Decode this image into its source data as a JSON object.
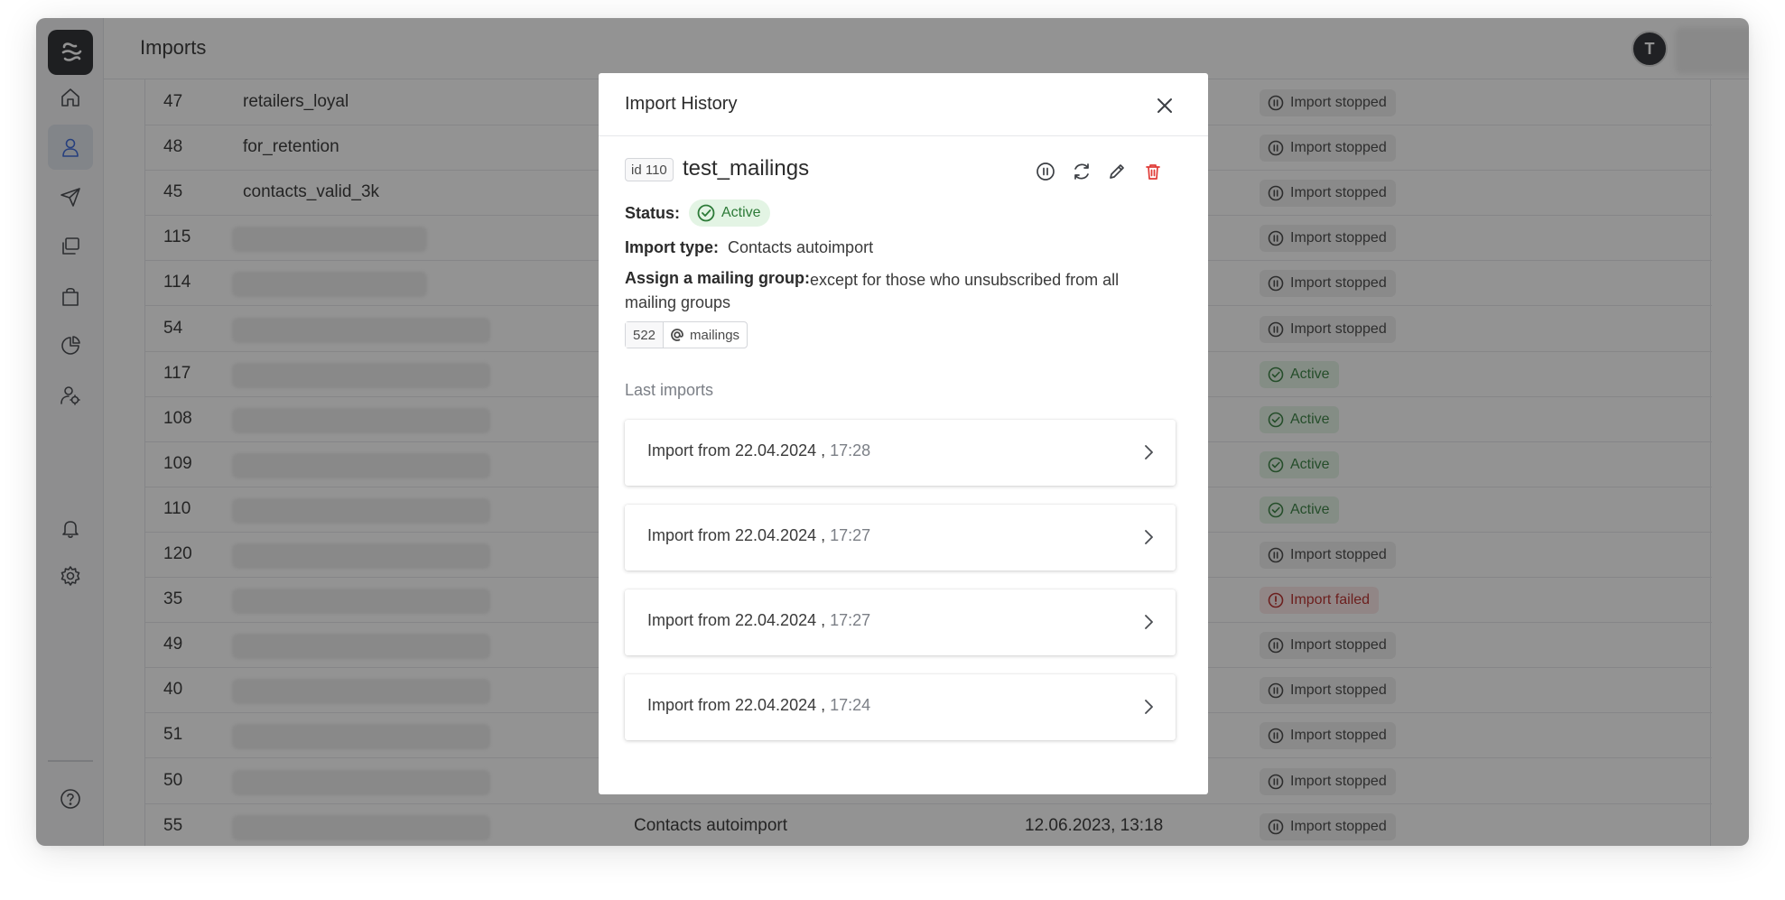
{
  "header": {
    "title": "Imports",
    "avatar_letter": "T"
  },
  "sidebar": {
    "items": [
      {
        "name": "home",
        "icon": "home-icon",
        "active": false
      },
      {
        "name": "contacts",
        "icon": "user-icon",
        "active": true
      },
      {
        "name": "mailings",
        "icon": "send-icon",
        "active": false
      },
      {
        "name": "templates",
        "icon": "copy-icon",
        "active": false
      },
      {
        "name": "shop",
        "icon": "shopping-bag-icon",
        "active": false
      },
      {
        "name": "analytics",
        "icon": "pie-chart-icon",
        "active": false
      },
      {
        "name": "users-settings",
        "icon": "user-settings-icon",
        "active": false
      },
      {
        "name": "notifications",
        "icon": "bell-icon",
        "active": false
      },
      {
        "name": "settings",
        "icon": "gear-icon",
        "active": false
      },
      {
        "name": "help",
        "icon": "help-icon",
        "active": false
      }
    ]
  },
  "table": {
    "rows": [
      {
        "id": "47",
        "name": "retailers_loyal",
        "type": "",
        "date": "",
        "status": "Import stopped",
        "kind": "stopped"
      },
      {
        "id": "48",
        "name": "for_retention",
        "type": "",
        "date": "",
        "status": "Import stopped",
        "kind": "stopped"
      },
      {
        "id": "45",
        "name": "contacts_valid_3k",
        "type": "",
        "date": "",
        "status": "Import stopped",
        "kind": "stopped"
      },
      {
        "id": "115",
        "name": "",
        "type": "",
        "date": "",
        "status": "Import stopped",
        "kind": "stopped"
      },
      {
        "id": "114",
        "name": "",
        "type": "",
        "date": "",
        "status": "Import stopped",
        "kind": "stopped"
      },
      {
        "id": "54",
        "name": "",
        "type": "",
        "date": "",
        "status": "Import stopped",
        "kind": "stopped"
      },
      {
        "id": "117",
        "name": "",
        "type": "",
        "date": "",
        "status": "Active",
        "kind": "active"
      },
      {
        "id": "108",
        "name": "",
        "type": "",
        "date": "",
        "status": "Active",
        "kind": "active"
      },
      {
        "id": "109",
        "name": "",
        "type": "",
        "date": "",
        "status": "Active",
        "kind": "active"
      },
      {
        "id": "110",
        "name": "",
        "type": "",
        "date": "",
        "status": "Active",
        "kind": "active"
      },
      {
        "id": "120",
        "name": "",
        "type": "",
        "date": "",
        "status": "Import stopped",
        "kind": "stopped"
      },
      {
        "id": "35",
        "name": "",
        "type": "",
        "date": "",
        "status": "Import failed",
        "kind": "failed"
      },
      {
        "id": "49",
        "name": "",
        "type": "",
        "date": "",
        "status": "Import stopped",
        "kind": "stopped"
      },
      {
        "id": "40",
        "name": "",
        "type": "",
        "date": "",
        "status": "Import stopped",
        "kind": "stopped"
      },
      {
        "id": "51",
        "name": "",
        "type": "",
        "date": "",
        "status": "Import stopped",
        "kind": "stopped"
      },
      {
        "id": "50",
        "name": "",
        "type": "",
        "date": "",
        "status": "Import stopped",
        "kind": "stopped"
      },
      {
        "id": "55",
        "name": "",
        "type": "Contacts autoimport",
        "date": "12.06.2023, 13:18",
        "status": "Import stopped",
        "kind": "stopped"
      }
    ]
  },
  "modal": {
    "title": "Import History",
    "id_label": "id 110",
    "import_name": "test_mailings",
    "status_label": "Status:",
    "status_value": "Active",
    "type_label": "Import type:",
    "type_value": "Contacts autoimport",
    "group_label": "Assign a mailing group:",
    "group_value": "except for those who unsubscribed from all mailing groups",
    "group_count": "522",
    "group_name": "mailings",
    "last_imports_title": "Last imports",
    "imports": [
      {
        "label": "Import from 22.04.2024 ,",
        "time": "17:28"
      },
      {
        "label": "Import from 22.04.2024 ,",
        "time": "17:27"
      },
      {
        "label": "Import from 22.04.2024 ,",
        "time": "17:27"
      },
      {
        "label": "Import from 22.04.2024 ,",
        "time": "17:24"
      }
    ]
  },
  "colors": {
    "accent": "#2f5fd6",
    "active_green": "#2c7a37",
    "failed_red": "#b5221f",
    "danger_icon": "#e03a36",
    "sidebar_bg": "#f5f6f8",
    "overlay": "rgba(30,30,30,0.48)"
  }
}
